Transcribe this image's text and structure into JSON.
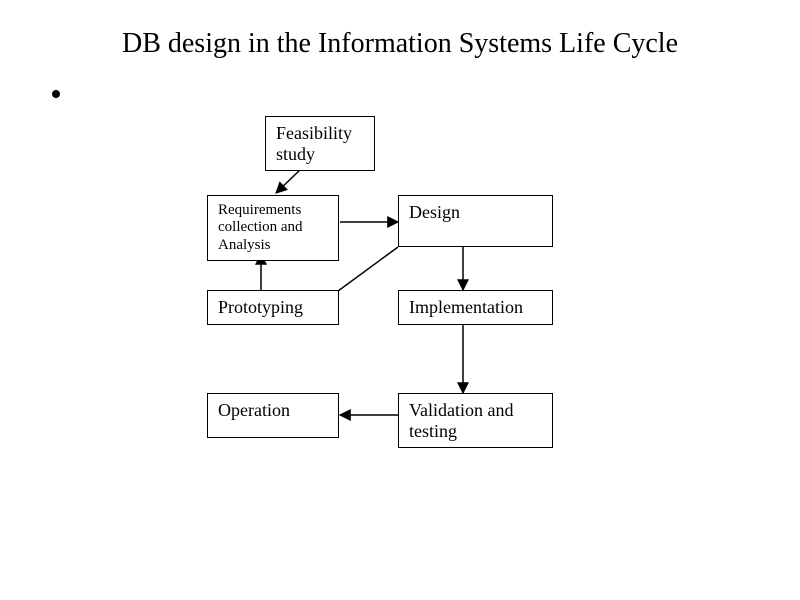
{
  "title": "DB design in the Information Systems Life Cycle",
  "boxes": {
    "feasibility": "Feasibility\nstudy",
    "requirements": "Requirements\ncollection and\nAnalysis",
    "design": "Design",
    "prototyping": "Prototyping",
    "implementation": "Implementation",
    "operation": "Operation",
    "validation": "Validation and\ntesting"
  },
  "arrows": [
    {
      "from": "feasibility",
      "to": "requirements"
    },
    {
      "from": "requirements",
      "to": "design"
    },
    {
      "from": "design",
      "to": "implementation"
    },
    {
      "from": "design",
      "to": "prototyping"
    },
    {
      "from": "prototyping",
      "to": "requirements"
    },
    {
      "from": "implementation",
      "to": "validation"
    },
    {
      "from": "validation",
      "to": "operation"
    }
  ]
}
